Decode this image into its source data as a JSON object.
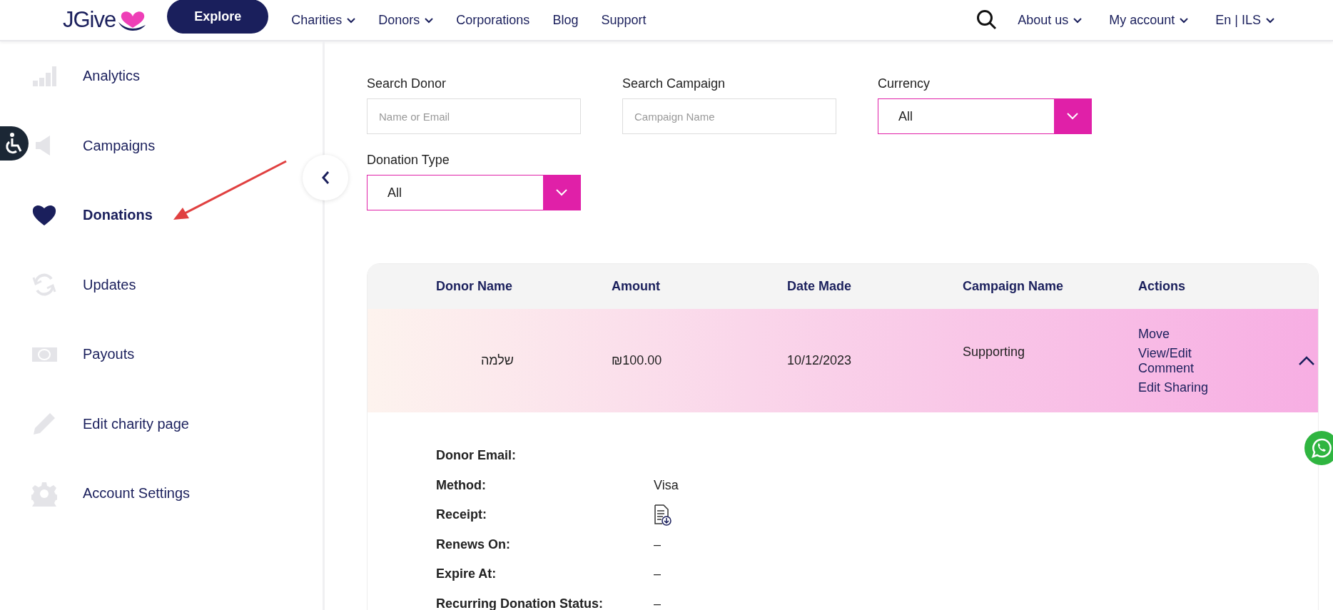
{
  "header": {
    "logo": "JGive",
    "explore": "Explore",
    "nav": [
      {
        "label": "Charities",
        "dropdown": true
      },
      {
        "label": "Donors",
        "dropdown": true
      },
      {
        "label": "Corporations",
        "dropdown": false
      },
      {
        "label": "Blog",
        "dropdown": false
      },
      {
        "label": "Support",
        "dropdown": false
      }
    ],
    "right_nav": [
      {
        "label": "About us",
        "dropdown": true
      },
      {
        "label": "My account",
        "dropdown": true
      },
      {
        "label": "En | ILS",
        "dropdown": true
      }
    ]
  },
  "sidebar": {
    "items": [
      {
        "label": "Analytics",
        "selected": false
      },
      {
        "label": "Campaigns",
        "selected": false
      },
      {
        "label": "Donations",
        "selected": true
      },
      {
        "label": "Updates",
        "selected": false
      },
      {
        "label": "Payouts",
        "selected": false
      },
      {
        "label": "Edit charity page",
        "selected": false
      },
      {
        "label": "Account Settings",
        "selected": false
      }
    ]
  },
  "filters": [
    {
      "label": "Search Donor",
      "kind": "text",
      "placeholder": "Name or Email"
    },
    {
      "label": "Search Campaign",
      "kind": "text",
      "placeholder": "Campaign Name"
    },
    {
      "label": "Currency",
      "kind": "select",
      "value": "All"
    },
    {
      "label": "Donation Type",
      "kind": "select",
      "value": "All"
    }
  ],
  "table": {
    "columns": [
      "Donor Name",
      "Amount",
      "Date Made",
      "Campaign Name",
      "Actions"
    ],
    "rows": [
      {
        "donor_name": "שלמה",
        "amount": "₪100.00",
        "date_made": "10/12/2023",
        "campaign_name": "Supporting",
        "actions": [
          "Move",
          "View/Edit Comment",
          "Edit Sharing"
        ],
        "expanded": true,
        "details": [
          {
            "label": "Donor Email:",
            "kind": "none"
          },
          {
            "label": "Method:",
            "kind": "text",
            "value": "Visa"
          },
          {
            "label": "Receipt:",
            "kind": "icon"
          },
          {
            "label": "Renews On:",
            "kind": "text",
            "value": "–"
          },
          {
            "label": "Expire At:",
            "kind": "text",
            "value": "–"
          },
          {
            "label": "Recurring Donation Status:",
            "kind": "text",
            "value": "–"
          }
        ]
      }
    ]
  }
}
